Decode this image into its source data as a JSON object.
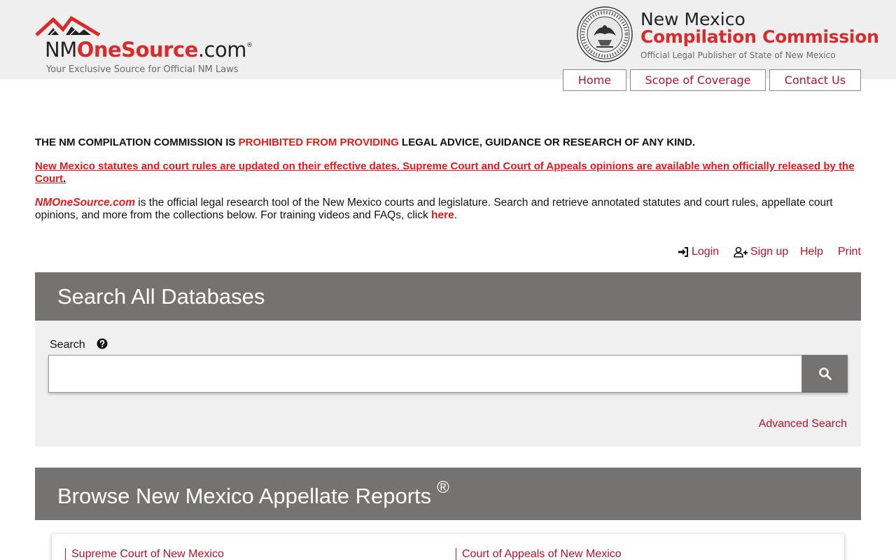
{
  "header": {
    "logo_left": {
      "part_nm": "NM",
      "part_one": "OneSource",
      "part_com": ".com",
      "reg_mark": "®",
      "tagline": "Your Exclusive Source for Official NM Laws"
    },
    "logo_right": {
      "line1": "New Mexico",
      "line2": "Compilation Commission",
      "line3": "Official Legal Publisher of State of New Mexico"
    },
    "nav": {
      "home": "Home",
      "scope": "Scope of Coverage",
      "contact": "Contact Us"
    }
  },
  "notices": {
    "line1_pre": "THE NM COMPILATION COMMISSION IS ",
    "line1_red": "PROHIBITED FROM PROVIDING",
    "line1_post": " LEGAL ADVICE, GUIDANCE OR RESEARCH OF ANY KIND.",
    "line2": "New Mexico statutes and court rules are updated on their effective dates.  Supreme Court and Court of Appeals opinions are available when officially released by the Court",
    "line2_end": ".",
    "line3_brand": "NMOneSource.com",
    "line3_body": " is the official legal research tool of the New Mexico courts and legislature.  Search and retrieve annotated statutes and court rules, appellate court opinions, and more from the collections below.  For training videos and FAQs, click ",
    "line3_link": "here",
    "line3_end": "."
  },
  "utility": {
    "login": "Login",
    "signup": "Sign up",
    "help": "Help",
    "print": "Print"
  },
  "search": {
    "title": "Search All Databases",
    "label": "Search",
    "value": "",
    "placeholder": "",
    "advanced": "Advanced Search"
  },
  "browse": {
    "title": "Browse New Mexico Appellate Reports",
    "reg_mark": "®",
    "links": [
      "Supreme Court of New Mexico",
      "Court of Appeals of New Mexico"
    ]
  },
  "colors": {
    "brand_red": "#d92b2b",
    "link_red": "#b3142b",
    "panel_gray": "#757371",
    "header_bg": "#efefef"
  },
  "icons": {
    "login": "sign-in-icon",
    "signup": "user-plus-icon",
    "help": "question-circle-icon",
    "search": "search-icon",
    "seal": "state-seal-icon",
    "logo": "mountain-roof-icon"
  }
}
